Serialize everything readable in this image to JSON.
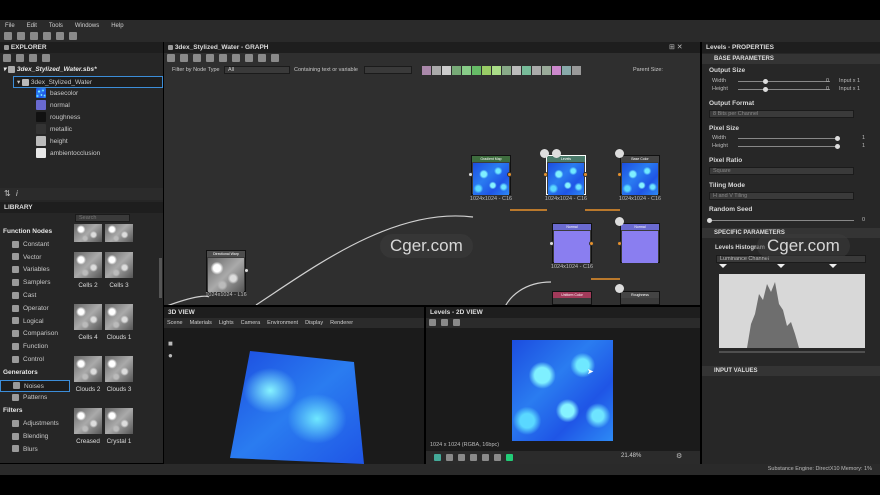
{
  "menu": [
    "File",
    "Edit",
    "Tools",
    "Windows",
    "Help"
  ],
  "explorer": {
    "title": "EXPLORER",
    "package": "3dex_Stylized_Water.sbs*",
    "graph": "3dex_Stylized_Water",
    "items": [
      "basecolor",
      "normal",
      "roughness",
      "metallic",
      "height",
      "ambientocclusion"
    ]
  },
  "library": {
    "title": "LIBRARY",
    "search_placeholder": "Search",
    "sections": [
      {
        "head": "Function Nodes",
        "items": [
          "Constant",
          "Vector",
          "Variables",
          "Samplers",
          "Cast",
          "Operator",
          "Logical",
          "Comparison",
          "Function",
          "Control"
        ]
      },
      {
        "head": "Generators",
        "items": [
          "Noises",
          "Patterns"
        ]
      },
      {
        "head": "Filters",
        "items": [
          "Adjustments",
          "Blending",
          "Blurs"
        ]
      }
    ],
    "thumbs": [
      "Cells 2",
      "Cells 3",
      "Cells 4",
      "Clouds 1",
      "Clouds 2",
      "Clouds 3",
      "Creased",
      "Crystal 1"
    ]
  },
  "graph": {
    "title": "3dex_Stylized_Water - GRAPH",
    "filter_label": "Filter by Node Type",
    "filter_value": "All",
    "contains_label": "Containing text or variable",
    "parent_size": "Parent Size:",
    "nodes": [
      {
        "title": "Directional Warp",
        "size": "1024x1024 - L16"
      },
      {
        "title": "Gradient Map",
        "size": "1024x1024 - C16"
      },
      {
        "title": "Levels",
        "size": "1024x1024 - C16"
      },
      {
        "title": "Base Color",
        "size": "1024x1024 - C16"
      },
      {
        "title": "Normal",
        "size": "1024x1024 - C16"
      },
      {
        "title": "Normal",
        "size": ""
      },
      {
        "title": "Uniform Color",
        "size": ""
      },
      {
        "title": "Roughness",
        "size": ""
      }
    ]
  },
  "view3d": {
    "title": "3D VIEW",
    "menu": [
      "Scene",
      "Materials",
      "Lights",
      "Camera",
      "Environment",
      "Display",
      "Renderer"
    ]
  },
  "view2d": {
    "title": "Levels - 2D VIEW",
    "info": "1024 x 1024 (RGBA, 16bpc)",
    "zoom": "21.48%"
  },
  "properties": {
    "title": "Levels - PROPERTIES",
    "base": "BASE PARAMETERS",
    "output_size": "Output Size",
    "width": "Width",
    "height": "Height",
    "os_w_val": "0",
    "os_h_val": "0",
    "os_w_rel": "Input x 1",
    "os_h_rel": "Input x 1",
    "output_format": "Output Format",
    "output_format_value": "8 Bits per Channel",
    "pixel_size": "Pixel Size",
    "ps_w_val": "1",
    "ps_h_val": "1",
    "pixel_ratio": "Pixel Ratio",
    "pixel_ratio_value": "Square",
    "tiling_mode": "Tiling Mode",
    "tiling_value": "H and V Tiling",
    "random_seed": "Random Seed",
    "random_seed_val": "0",
    "specific": "SPECIFIC PARAMETERS",
    "levels_hist": "Levels Histogram",
    "luminance": "Luminance Channel",
    "input_values": "INPUT VALUES"
  },
  "status": "Substance Engine: DirectX10  Memory: 1%",
  "watermark": "Cger.com",
  "colors": {
    "accent": "#3c8dd8",
    "selection": "#3a5f8a",
    "wire": "#d0d0d0",
    "orange_wire": "#e8922c"
  }
}
